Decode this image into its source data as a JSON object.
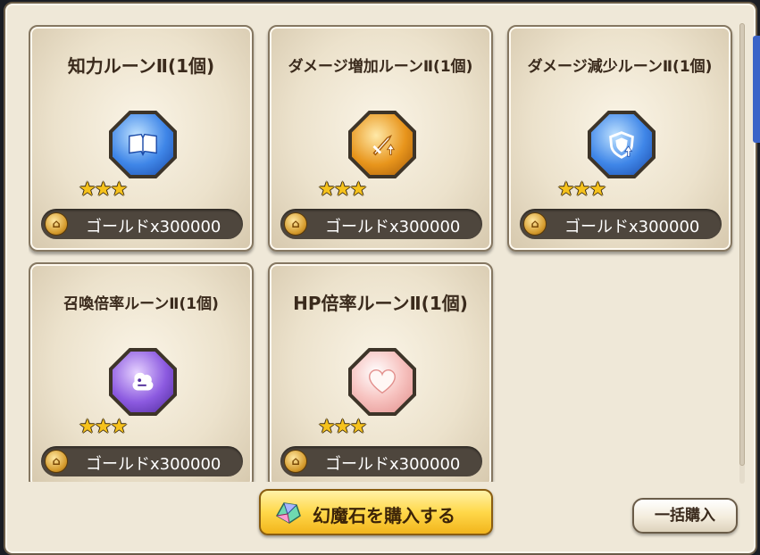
{
  "items": [
    {
      "title": "知力ルーンⅡ(1個)",
      "icon": "book-icon",
      "gem_color": "blue",
      "rarity": 3,
      "price": "ゴールドx300000"
    },
    {
      "title": "ダメージ増加ルーンⅡ(1個)",
      "icon": "sword-up-icon",
      "gem_color": "orange",
      "rarity": 3,
      "price": "ゴールドx300000"
    },
    {
      "title": "ダメージ減少ルーンⅡ(1個)",
      "icon": "shield-down-icon",
      "gem_color": "blue",
      "rarity": 3,
      "price": "ゴールドx300000"
    },
    {
      "title": "召喚倍率ルーンⅡ(1個)",
      "icon": "beast-icon",
      "gem_color": "purple",
      "rarity": 3,
      "price": "ゴールドx300000"
    },
    {
      "title": "HP倍率ルーンⅡ(1個)",
      "icon": "heart-icon",
      "gem_color": "pink",
      "rarity": 3,
      "price": "ゴールドx300000"
    }
  ],
  "stars_text": "★★★",
  "buy_button": {
    "label": "幻魔石を購入する",
    "icon": "magic-stone-icon"
  },
  "bulk_button": {
    "label": "一括購入"
  },
  "colors": {
    "panel": "#efe8d8",
    "price_bar": "#4e463d",
    "buy_button": "#ffd84a"
  }
}
